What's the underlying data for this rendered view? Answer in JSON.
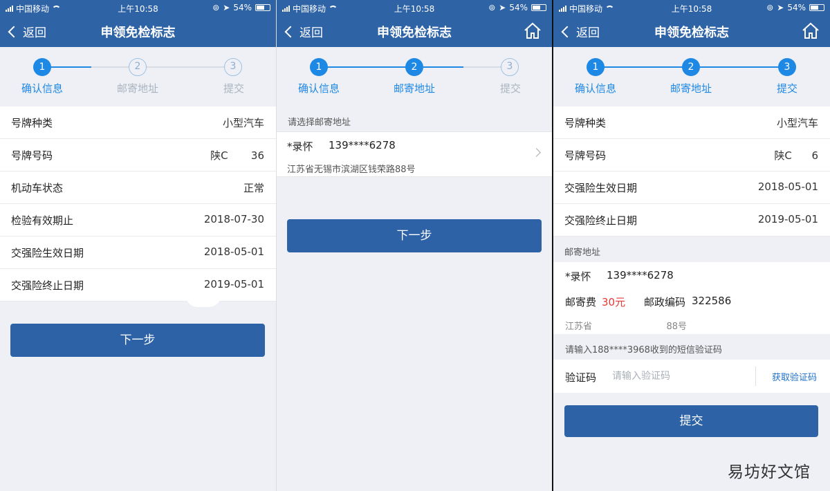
{
  "status": {
    "carrier": "中国移动",
    "time": "上午10:58",
    "battery": "54%"
  },
  "nav": {
    "back_label": "返回",
    "title": "申领免检标志"
  },
  "steps": [
    "确认信息",
    "邮寄地址",
    "提交"
  ],
  "step_numbers": [
    "1",
    "2",
    "3"
  ],
  "screen1": {
    "rows": [
      {
        "label": "号牌种类",
        "value": "小型汽车"
      },
      {
        "label": "号牌号码",
        "value": "陕C       36"
      },
      {
        "label": "机动车状态",
        "value": "正常"
      },
      {
        "label": "检验有效期止",
        "value": "2018-07-30"
      },
      {
        "label": "交强险生效日期",
        "value": "2018-05-01"
      },
      {
        "label": "交强险终止日期",
        "value": "2019-05-01"
      }
    ],
    "next_label": "下一步"
  },
  "screen2": {
    "section_label": "请选择邮寄地址",
    "address": {
      "name": "*录怀",
      "phone": "139****6278",
      "detail": "江苏省无锡市滨湖区钱荣路88号"
    },
    "next_label": "下一步"
  },
  "screen3": {
    "rows": [
      {
        "label": "号牌种类",
        "value": "小型汽车"
      },
      {
        "label": "号牌号码",
        "value": "陕C      6"
      },
      {
        "label": "交强险生效日期",
        "value": "2018-05-01"
      },
      {
        "label": "交强险终止日期",
        "value": "2019-05-01"
      }
    ],
    "mail_section_label": "邮寄地址",
    "mail": {
      "name": "*录怀",
      "phone": "139****6278",
      "fee_label": "邮寄费",
      "fee_value": "30元",
      "postcode_label": "邮政编码",
      "postcode_value": "322586",
      "address_partial": "江苏省                          88号"
    },
    "sms_hint": "请输入188****3968收到的短信验证码",
    "code_label": "验证码",
    "code_placeholder": "请输入验证码",
    "get_code_label": "获取验证码",
    "submit_label": "提交"
  },
  "watermark": "易坊好文馆",
  "colors": {
    "header": "#2e63a6",
    "accent": "#1e88e5",
    "button": "#2d63a6",
    "fee": "#e53935"
  }
}
